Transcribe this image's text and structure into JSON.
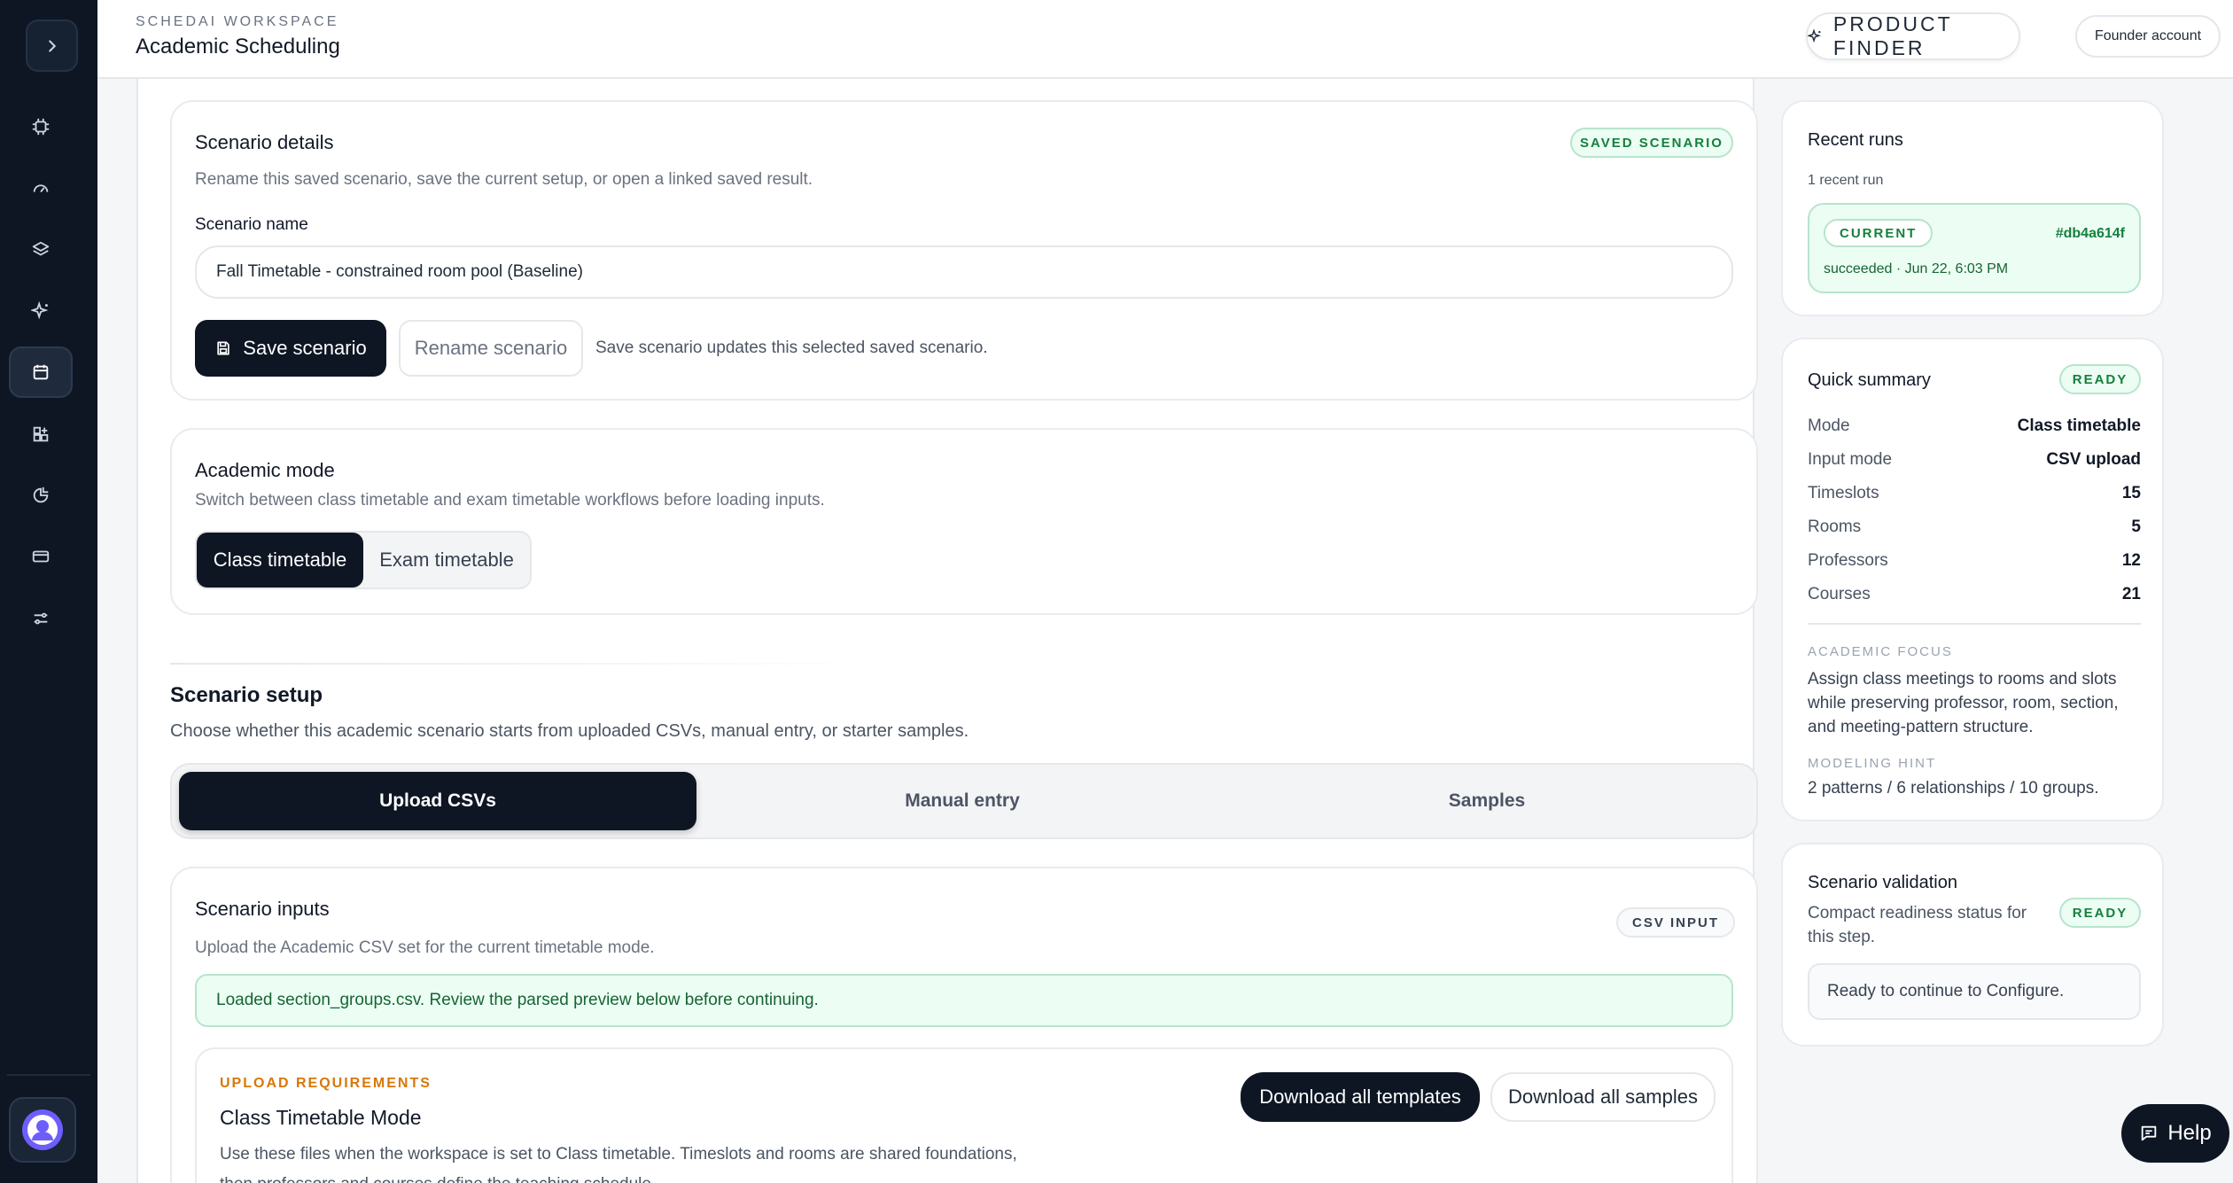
{
  "header": {
    "workspace_label": "SCHEDAI WORKSPACE",
    "title": "Academic Scheduling",
    "product_finder": "PRODUCT FINDER",
    "account": "Founder account"
  },
  "sidebar": {
    "items": [
      {
        "icon": "chip-icon"
      },
      {
        "icon": "gauge-icon"
      },
      {
        "icon": "layers-icon"
      },
      {
        "icon": "sparkle-icon"
      },
      {
        "icon": "calendar-icon",
        "active": true
      },
      {
        "icon": "grid-plus-icon"
      },
      {
        "icon": "analytics-icon"
      },
      {
        "icon": "card-icon"
      },
      {
        "icon": "sliders-icon"
      }
    ]
  },
  "scenario_details": {
    "title": "Scenario details",
    "badge": "SAVED SCENARIO",
    "description": "Rename this saved scenario, save the current setup, or open a linked saved result.",
    "name_label": "Scenario name",
    "name_value": "Fall Timetable - constrained room pool (Baseline)",
    "save_button": "Save scenario",
    "rename_button": "Rename scenario",
    "hint": "Save scenario updates this selected saved scenario."
  },
  "academic_mode": {
    "title": "Academic mode",
    "description": "Switch between class timetable and exam timetable workflows before loading inputs.",
    "options": [
      "Class timetable",
      "Exam timetable"
    ],
    "selected": "Class timetable"
  },
  "scenario_setup": {
    "title": "Scenario setup",
    "description": "Choose whether this academic scenario starts from uploaded CSVs, manual entry, or starter samples.",
    "tabs": [
      "Upload CSVs",
      "Manual entry",
      "Samples"
    ],
    "selected": "Upload CSVs"
  },
  "scenario_inputs": {
    "title": "Scenario inputs",
    "badge": "CSV INPUT",
    "description": "Upload the Academic CSV set for the current timetable mode.",
    "alert": "Loaded section_groups.csv. Review the parsed preview below before continuing.",
    "req_label": "UPLOAD REQUIREMENTS",
    "req_title": "Class Timetable Mode",
    "req_text_1": "Use these files when the workspace is set to Class timetable. Timeslots and rooms are shared foundations,",
    "req_text_2": "then professors and courses define the teaching schedule.",
    "download_templates": "Download all templates",
    "download_samples": "Download all samples"
  },
  "recent_runs": {
    "title": "Recent runs",
    "count": "1 recent run",
    "run_badge": "CURRENT",
    "run_id": "#db4a614f",
    "run_status": "succeeded · Jun 22, 6:03 PM"
  },
  "quick_summary": {
    "title": "Quick summary",
    "badge": "READY",
    "rows": [
      {
        "k": "Mode",
        "v": "Class timetable"
      },
      {
        "k": "Input mode",
        "v": "CSV upload"
      },
      {
        "k": "Timeslots",
        "v": "15"
      },
      {
        "k": "Rooms",
        "v": "5"
      },
      {
        "k": "Professors",
        "v": "12"
      },
      {
        "k": "Courses",
        "v": "21"
      }
    ],
    "focus_label": "ACADEMIC FOCUS",
    "focus_text": "Assign class meetings to rooms and slots while preserving professor, room, section, and meeting-pattern structure.",
    "hint_label": "MODELING HINT",
    "hint_text": "2 patterns / 6 relationships / 10 groups."
  },
  "validation": {
    "title": "Scenario validation",
    "description": "Compact readiness status for this step.",
    "badge": "READY",
    "message": "Ready to continue to Configure."
  },
  "help": {
    "label": "Help"
  }
}
